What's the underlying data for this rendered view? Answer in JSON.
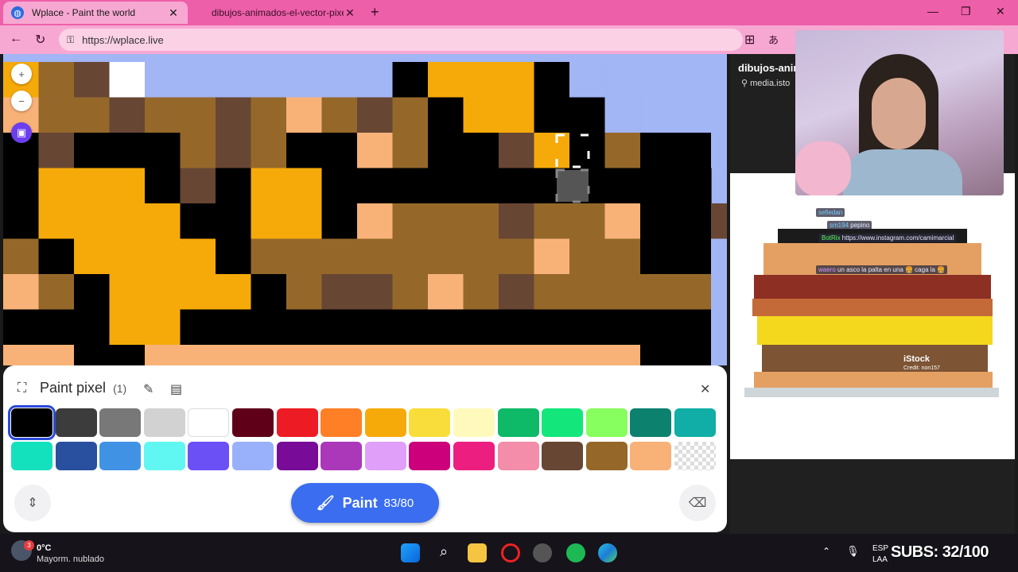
{
  "browser": {
    "tabs": [
      {
        "title": "Wplace - Paint the world",
        "active": true
      },
      {
        "title": "dibujos-animados-el-vector-pixel",
        "active": false
      }
    ],
    "url": "https://wplace.live"
  },
  "paint_panel": {
    "title": "Paint pixel",
    "count": "(1)",
    "paint_button_label": "Paint",
    "paint_button_charges": "83/80",
    "selected_color": "#000000",
    "colors": [
      "#000000",
      "#3c3c3c",
      "#787878",
      "#d2d2d2",
      "#ffffff",
      "#600018",
      "#ed1c24",
      "#ff7f27",
      "#f6aa09",
      "#f9dd3b",
      "#fffabc",
      "#0eb968",
      "#13e67b",
      "#87ff5e",
      "#0c816e",
      "#10aea6",
      "#13e1be",
      "#28509e",
      "#4093e4",
      "#60f7f2",
      "#6b50f6",
      "#99b1fb",
      "#780c99",
      "#aa38b9",
      "#e09ff9",
      "#cb007a",
      "#ec1f80",
      "#f38da9",
      "#684634",
      "#95682a",
      "#f8b277",
      "transparent"
    ]
  },
  "right_pane": {
    "header": "dibujos-anim",
    "source": "media.isto",
    "watermark": "iStock",
    "credit": "Credit: non157",
    "chat": [
      {
        "user": "sefiedan",
        "text": ""
      },
      {
        "user": "sm194",
        "text": "pepino"
      },
      {
        "user": "BotRix",
        "text": "https://www.instagram.com/camimarcial"
      },
      {
        "user": "waero",
        "text": "un asco la palta en una 🍔 caga la 🍔"
      }
    ]
  },
  "taskbar": {
    "weather_temp": "0°C",
    "weather_desc": "Mayorm. nublado",
    "lang_line1": "ESP",
    "lang_line2": "LAA",
    "subs": "SUBS: 32/100"
  }
}
